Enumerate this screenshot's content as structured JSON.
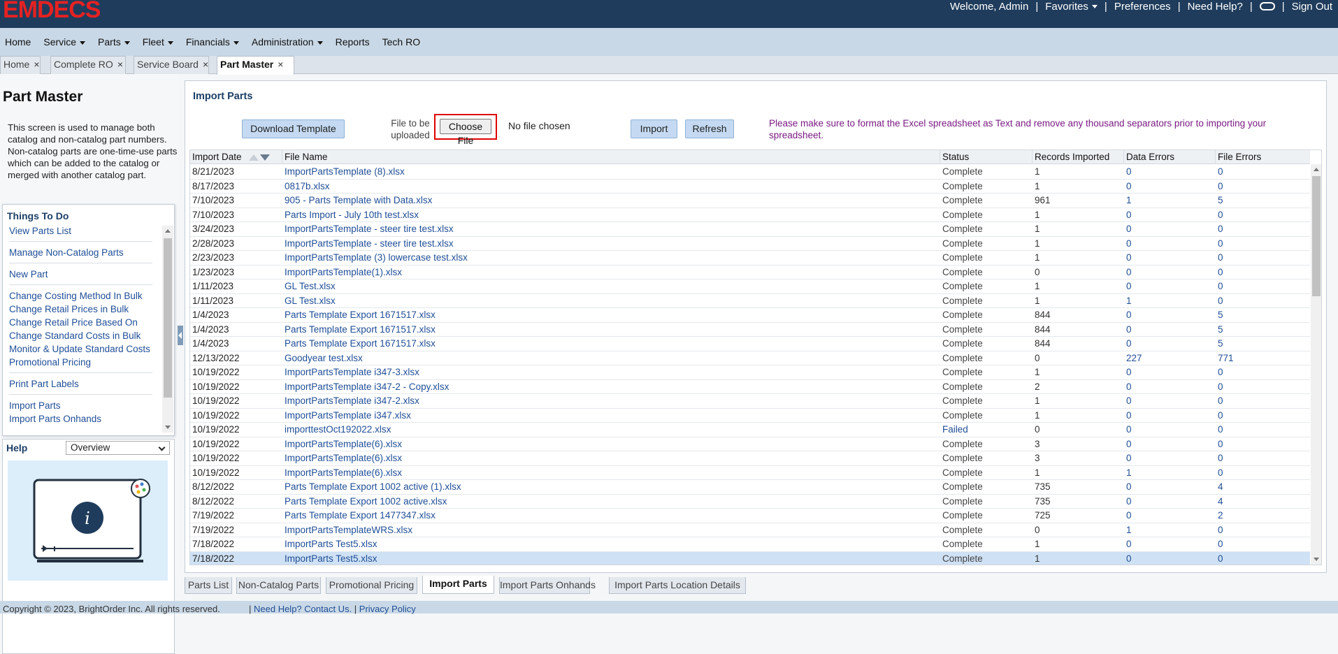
{
  "header": {
    "logo": "EMDECS",
    "welcome": "Welcome, Admin",
    "favorites": "Favorites",
    "preferences": "Preferences",
    "need_help": "Need Help?",
    "sign_out": "Sign Out"
  },
  "menu": {
    "items": [
      {
        "label": "Home",
        "dropdown": false
      },
      {
        "label": "Service",
        "dropdown": true
      },
      {
        "label": "Parts",
        "dropdown": true
      },
      {
        "label": "Fleet",
        "dropdown": true
      },
      {
        "label": "Financials",
        "dropdown": true
      },
      {
        "label": "Administration",
        "dropdown": true
      },
      {
        "label": "Reports",
        "dropdown": false
      },
      {
        "label": "Tech RO",
        "dropdown": false
      }
    ]
  },
  "tabs": [
    {
      "label": "Home"
    },
    {
      "label": "Complete RO"
    },
    {
      "label": "Service Board"
    },
    {
      "label": "Part Master"
    }
  ],
  "left_panel": {
    "title": "Part Master",
    "description": "This screen is used to manage both catalog and non-catalog part numbers. Non-catalog parts are one-time-use parts which can be added to the catalog or merged with another catalog part.",
    "things_to_do": {
      "title": "Things To Do",
      "groups": [
        [
          "View Parts List"
        ],
        [
          "Manage Non-Catalog Parts"
        ],
        [
          "New Part"
        ],
        [
          "Change Costing Method In Bulk",
          "Change Retail Prices in Bulk",
          "Change Retail Price Based On",
          "Change Standard Costs in Bulk",
          "Monitor & Update Standard Costs",
          "Promotional Pricing"
        ],
        [
          "Print Part Labels"
        ],
        [
          "Import Parts",
          "Import Parts Onhands"
        ]
      ]
    },
    "help": {
      "title": "Help",
      "selected": "Overview"
    }
  },
  "import": {
    "section_title": "Import Parts",
    "download_template": "Download Template",
    "file_label": "File to be uploaded",
    "choose_file": "Choose File",
    "no_file": "No file chosen",
    "import_button": "Import",
    "refresh_button": "Refresh",
    "notice": "Please make sure to format the Excel spreadsheet as Text and remove any thousand separators prior to importing your spreadsheet."
  },
  "table": {
    "columns": [
      "Import Date",
      "File Name",
      "Status",
      "Records Imported",
      "Data Errors",
      "File Errors"
    ],
    "rows": [
      [
        "8/21/2023",
        "ImportPartsTemplate (8).xlsx",
        "Complete",
        "1",
        "0",
        "0"
      ],
      [
        "8/17/2023",
        "0817b.xlsx",
        "Complete",
        "1",
        "0",
        "0"
      ],
      [
        "7/10/2023",
        "905 - Parts Template with Data.xlsx",
        "Complete",
        "961",
        "1",
        "5"
      ],
      [
        "7/10/2023",
        "Parts Import - July 10th test.xlsx",
        "Complete",
        "1",
        "0",
        "0"
      ],
      [
        "3/24/2023",
        "ImportPartsTemplate - steer tire test.xlsx",
        "Complete",
        "1",
        "0",
        "0"
      ],
      [
        "2/28/2023",
        "ImportPartsTemplate - steer tire test.xlsx",
        "Complete",
        "1",
        "0",
        "0"
      ],
      [
        "2/23/2023",
        "ImportPartsTemplate (3) lowercase test.xlsx",
        "Complete",
        "1",
        "0",
        "0"
      ],
      [
        "1/23/2023",
        "ImportPartsTemplate(1).xlsx",
        "Complete",
        "0",
        "0",
        "0"
      ],
      [
        "1/11/2023",
        "GL Test.xlsx",
        "Complete",
        "1",
        "0",
        "0"
      ],
      [
        "1/11/2023",
        "GL Test.xlsx",
        "Complete",
        "1",
        "1",
        "0"
      ],
      [
        "1/4/2023",
        "Parts Template Export 1671517.xlsx",
        "Complete",
        "844",
        "0",
        "5"
      ],
      [
        "1/4/2023",
        "Parts Template Export 1671517.xlsx",
        "Complete",
        "844",
        "0",
        "5"
      ],
      [
        "1/4/2023",
        "Parts Template Export 1671517.xlsx",
        "Complete",
        "844",
        "0",
        "5"
      ],
      [
        "12/13/2022",
        "Goodyear test.xlsx",
        "Complete",
        "0",
        "227",
        "771"
      ],
      [
        "10/19/2022",
        "ImportPartsTemplate i347-3.xlsx",
        "Complete",
        "1",
        "0",
        "0"
      ],
      [
        "10/19/2022",
        "ImportPartsTemplate i347-2 - Copy.xlsx",
        "Complete",
        "2",
        "0",
        "0"
      ],
      [
        "10/19/2022",
        "ImportPartsTemplate i347-2.xlsx",
        "Complete",
        "1",
        "0",
        "0"
      ],
      [
        "10/19/2022",
        "ImportPartsTemplate i347.xlsx",
        "Complete",
        "1",
        "0",
        "0"
      ],
      [
        "10/19/2022",
        "importtestOct192022.xlsx",
        "Failed",
        "0",
        "0",
        "0"
      ],
      [
        "10/19/2022",
        "ImportPartsTemplate(6).xlsx",
        "Complete",
        "3",
        "0",
        "0"
      ],
      [
        "10/19/2022",
        "ImportPartsTemplate(6).xlsx",
        "Complete",
        "3",
        "0",
        "0"
      ],
      [
        "10/19/2022",
        "ImportPartsTemplate(6).xlsx",
        "Complete",
        "1",
        "1",
        "0"
      ],
      [
        "8/12/2022",
        "Parts Template Export 1002 active (1).xlsx",
        "Complete",
        "735",
        "0",
        "4"
      ],
      [
        "8/12/2022",
        "Parts Template Export 1002 active.xlsx",
        "Complete",
        "735",
        "0",
        "4"
      ],
      [
        "7/19/2022",
        "Parts Template Export 1477347.xlsx",
        "Complete",
        "725",
        "0",
        "2"
      ],
      [
        "7/19/2022",
        "ImportPartsTemplateWRS.xlsx",
        "Complete",
        "0",
        "1",
        "0"
      ],
      [
        "7/18/2022",
        "ImportParts Test5.xlsx",
        "Complete",
        "1",
        "0",
        "0"
      ],
      [
        "7/18/2022",
        "ImportParts Test5.xlsx",
        "Complete",
        "1",
        "0",
        "0"
      ]
    ],
    "selected_row": 27
  },
  "bottom_tabs": [
    {
      "label": "Parts List"
    },
    {
      "label": "Non-Catalog Parts"
    },
    {
      "label": "Promotional Pricing"
    },
    {
      "label": "Import Parts"
    },
    {
      "label": "Import Parts Onhands"
    },
    {
      "label": "Import Parts Location Details"
    }
  ],
  "footer": {
    "copyright": "Copyright © 2023, BrightOrder Inc. All rights reserved.",
    "help_link": "Need Help? Contact Us.",
    "privacy_link": "Privacy Policy"
  }
}
